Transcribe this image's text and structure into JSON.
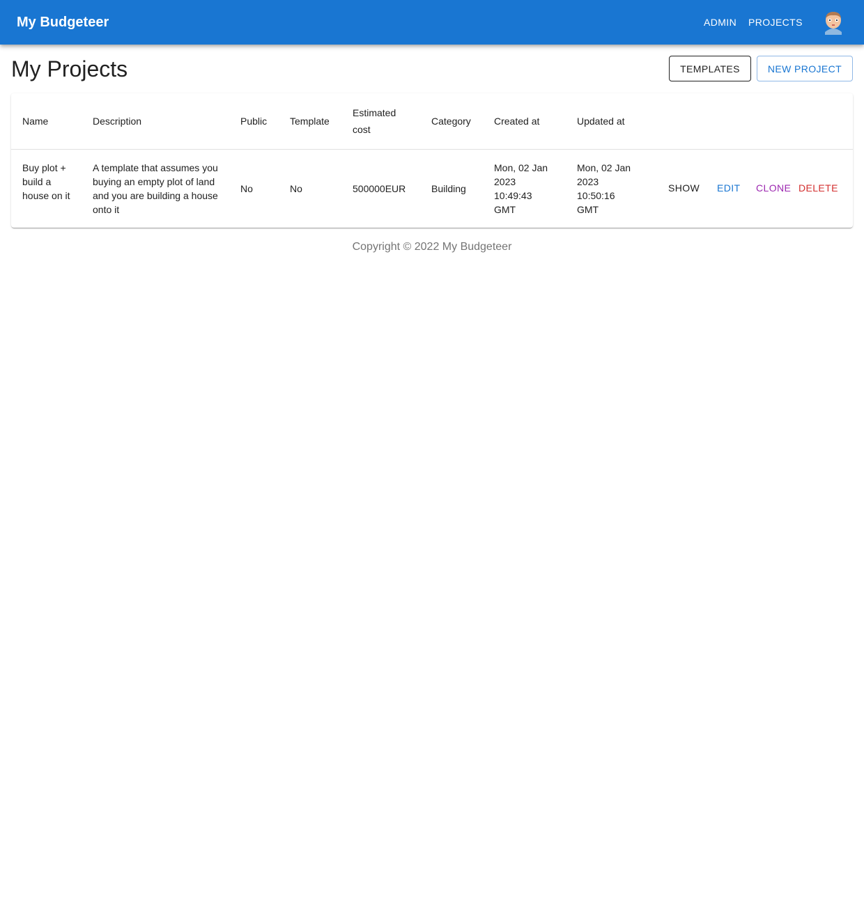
{
  "appbar": {
    "brand": "My Budgeteer",
    "nav": [
      "ADMIN",
      "PROJECTS"
    ],
    "avatar_icon": "avatar-icon",
    "color": "#1976d2"
  },
  "page": {
    "title": "My Projects",
    "buttons": {
      "templates": "TEMPLATES",
      "new_project": "NEW PROJECT"
    }
  },
  "table": {
    "columns": {
      "name": "Name",
      "description": "Description",
      "public": "Public",
      "template": "Template",
      "estimated_cost": "Estimated cost",
      "category": "Category",
      "created_at": "Created at",
      "updated_at": "Updated at"
    },
    "rows": [
      {
        "name": "Buy plot + build a house on it",
        "description": "A template that assumes you buying an empty plot of land and you are building a house onto it",
        "public": "No",
        "template": "No",
        "estimated_cost": "500000EUR",
        "category": "Building",
        "created_at": "Mon, 02 Jan 2023 10:49:43 GMT",
        "updated_at": "Mon, 02 Jan 2023 10:50:16 GMT",
        "actions": {
          "show": "SHOW",
          "edit": "EDIT",
          "clone": "CLONE",
          "delete": "DELETE"
        }
      }
    ]
  },
  "footer": {
    "text": "Copyright © 2022 My Budgeteer"
  },
  "colors": {
    "primary": "#1976d2",
    "clone": "#9c27b0",
    "delete": "#d32f2f"
  }
}
